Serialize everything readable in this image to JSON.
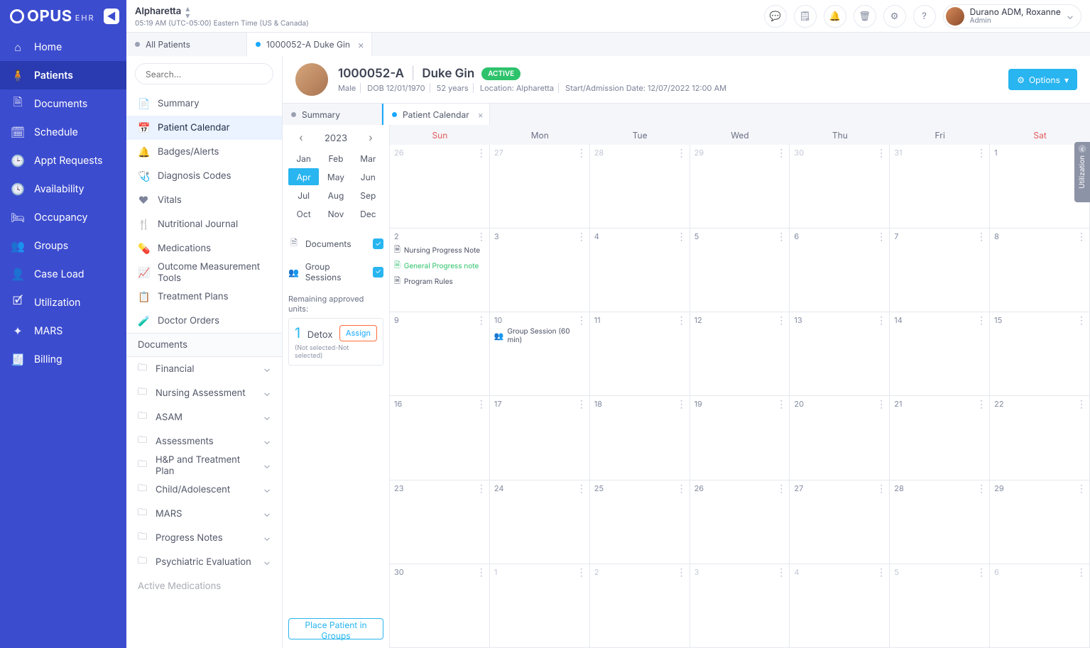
{
  "brand": {
    "name": "OPUS",
    "sub": "EHR"
  },
  "facility": {
    "name": "Alpharetta",
    "time": "05:19 AM (UTC-05:00) Eastern Time (US & Canada)"
  },
  "user": {
    "name": "Durano ADM, Roxanne",
    "role": "Admin"
  },
  "nav": [
    {
      "icon": "⌂",
      "label": "Home"
    },
    {
      "icon": "🧍",
      "label": "Patients",
      "active": true
    },
    {
      "icon": "🗎",
      "label": "Documents"
    },
    {
      "icon": "🗓",
      "label": "Schedule"
    },
    {
      "icon": "🕒",
      "label": "Appt Requests"
    },
    {
      "icon": "🕓",
      "label": "Availability"
    },
    {
      "icon": "🛏",
      "label": "Occupancy"
    },
    {
      "icon": "👥",
      "label": "Groups"
    },
    {
      "icon": "👤",
      "label": "Case Load"
    },
    {
      "icon": "🗹",
      "label": "Utilization"
    },
    {
      "icon": "✦",
      "label": "MARS"
    },
    {
      "icon": "🧾",
      "label": "Billing"
    }
  ],
  "top_tabs": [
    {
      "label": "All Patients",
      "dot": "#9aa1b3"
    },
    {
      "label": "1000052-A Duke Gin",
      "dot": "#1aa8ff",
      "closable": true,
      "active": true
    }
  ],
  "search": {
    "placeholder": "Search..."
  },
  "patient_menu": [
    {
      "icon": "📄",
      "label": "Summary"
    },
    {
      "icon": "📅",
      "label": "Patient Calendar",
      "sel": true
    },
    {
      "icon": "🔔",
      "label": "Badges/Alerts"
    },
    {
      "icon": "🩺",
      "label": "Diagnosis Codes"
    },
    {
      "icon": "❤",
      "label": "Vitals"
    },
    {
      "icon": "🍴",
      "label": "Nutritional Journal"
    },
    {
      "icon": "💊",
      "label": "Medications"
    },
    {
      "icon": "📈",
      "label": "Outcome Measurement Tools"
    },
    {
      "icon": "📋",
      "label": "Treatment Plans"
    },
    {
      "icon": "🧪",
      "label": "Doctor Orders"
    }
  ],
  "doc_section": "Documents",
  "doc_folders": [
    "Financial",
    "Nursing Assessment",
    "ASAM",
    "Assessments",
    "H&P and Treatment Plan",
    "Child/Adolescent",
    "MARS",
    "Progress Notes",
    "Psychiatric Evaluation"
  ],
  "doc_more": "Active Medications",
  "patient": {
    "id": "1000052-A",
    "name": "Duke Gin",
    "status": "ACTIVE",
    "gender": "Male",
    "dob": "DOB 12/01/1970",
    "age": "52 years",
    "location": "Location: Alpharetta",
    "admission": "Start/Admission Date: 12/07/2022 12:00 AM",
    "options": "Options"
  },
  "inner_tabs": [
    {
      "label": "Summary",
      "dot": "#9aa1b3"
    },
    {
      "label": "Patient Calendar",
      "dot": "#1aa8ff",
      "active": true,
      "closable": true
    }
  ],
  "year": "2023",
  "months": [
    "Jan",
    "Feb",
    "Mar",
    "Apr",
    "May",
    "Jun",
    "Jul",
    "Aug",
    "Sep",
    "Oct",
    "Nov",
    "Dec"
  ],
  "month_sel": "Apr",
  "filters": [
    {
      "icon": "🗎",
      "label": "Documents",
      "checked": true
    },
    {
      "icon": "👥",
      "label": "Group Sessions",
      "checked": true
    }
  ],
  "approved": {
    "header": "Remaining approved units:",
    "count": "1",
    "type": "Detox",
    "assign": "Assign",
    "sub": "(Not selected-Not selected)"
  },
  "place_btn": "Place Patient in Groups",
  "weekdays": [
    "Sun",
    "Mon",
    "Tue",
    "Wed",
    "Thu",
    "Fri",
    "Sat"
  ],
  "cells": [
    {
      "d": "26",
      "other": true
    },
    {
      "d": "27",
      "other": true
    },
    {
      "d": "28",
      "other": true
    },
    {
      "d": "29",
      "other": true
    },
    {
      "d": "30",
      "other": true
    },
    {
      "d": "31",
      "other": true
    },
    {
      "d": "1"
    },
    {
      "d": "2",
      "events": [
        {
          "icon": "🗎",
          "label": "Nursing Progress Note"
        },
        {
          "icon": "🗎",
          "label": "General Progress note",
          "cls": "green"
        },
        {
          "icon": "🗎",
          "label": "Program Rules"
        }
      ]
    },
    {
      "d": "3"
    },
    {
      "d": "4"
    },
    {
      "d": "5"
    },
    {
      "d": "6"
    },
    {
      "d": "7"
    },
    {
      "d": "8"
    },
    {
      "d": "9"
    },
    {
      "d": "10",
      "events": [
        {
          "icon": "👥",
          "label": "Group Session (60 min)"
        }
      ]
    },
    {
      "d": "11"
    },
    {
      "d": "12"
    },
    {
      "d": "13"
    },
    {
      "d": "14"
    },
    {
      "d": "15"
    },
    {
      "d": "16"
    },
    {
      "d": "17"
    },
    {
      "d": "18"
    },
    {
      "d": "19"
    },
    {
      "d": "20"
    },
    {
      "d": "21"
    },
    {
      "d": "22"
    },
    {
      "d": "23"
    },
    {
      "d": "24"
    },
    {
      "d": "25"
    },
    {
      "d": "26"
    },
    {
      "d": "27"
    },
    {
      "d": "28"
    },
    {
      "d": "29"
    },
    {
      "d": "30"
    },
    {
      "d": "1",
      "other": true
    },
    {
      "d": "2",
      "other": true
    },
    {
      "d": "3",
      "other": true
    },
    {
      "d": "4",
      "other": true
    },
    {
      "d": "5",
      "other": true
    },
    {
      "d": "6",
      "other": true
    }
  ],
  "util_flag": "Utilization"
}
